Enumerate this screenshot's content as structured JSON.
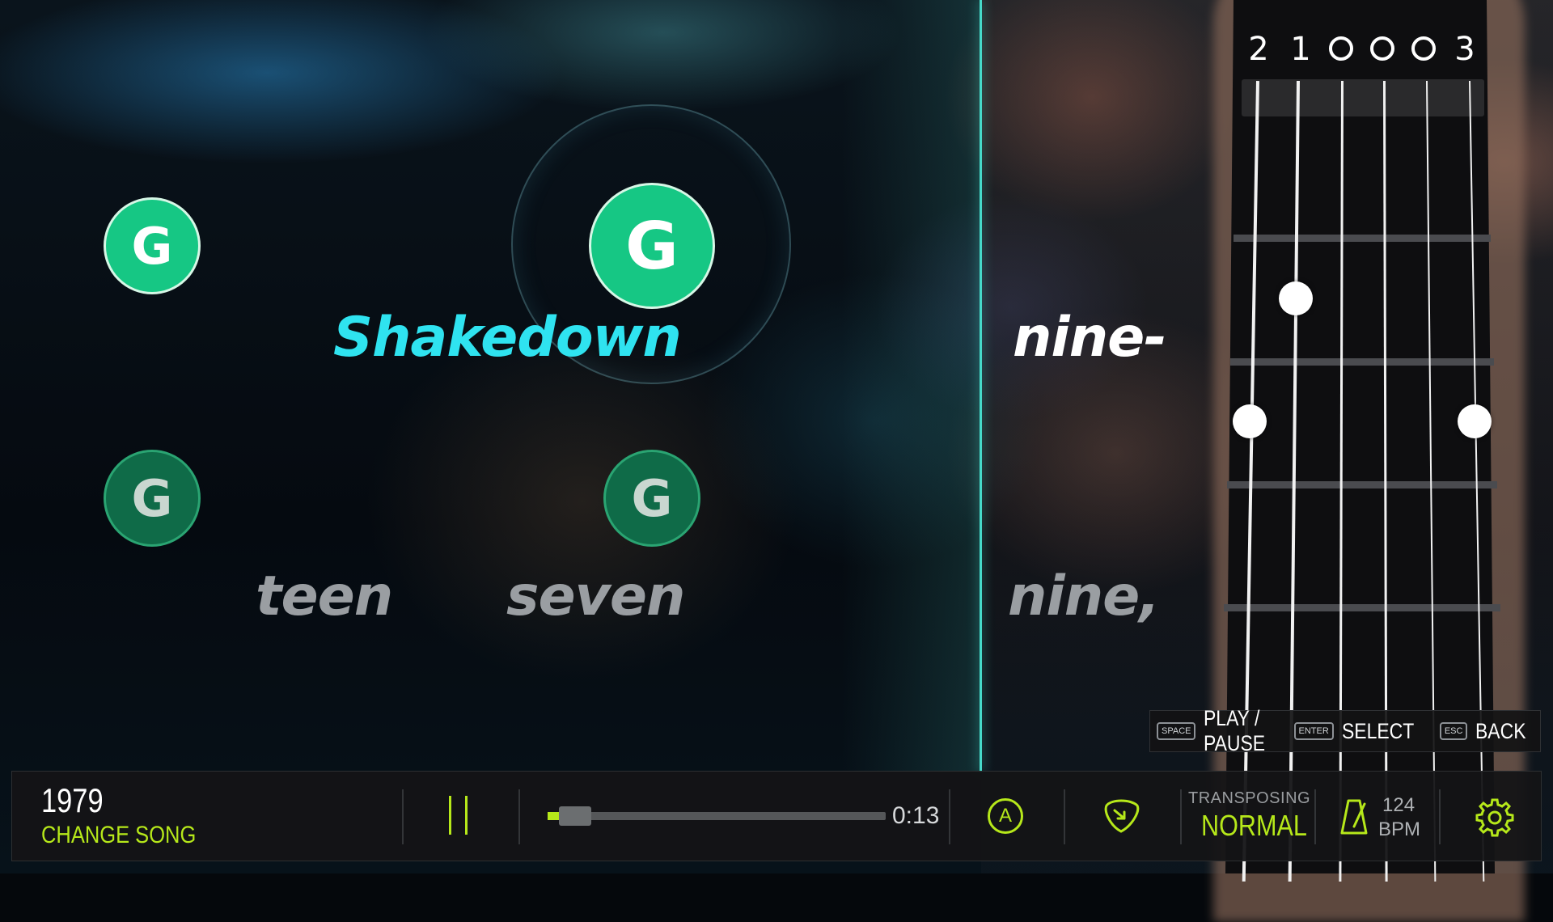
{
  "chords": {
    "top": [
      "G",
      "G"
    ],
    "bottom": [
      "G",
      "G"
    ]
  },
  "lyrics": {
    "line1": [
      "Shakedown",
      "nine-"
    ],
    "line2": [
      "teen",
      "seven",
      "nine,"
    ]
  },
  "fretboard": {
    "string_markers": [
      "2",
      "1",
      "o",
      "o",
      "o",
      "3"
    ]
  },
  "hints": {
    "play_key": "SPACE",
    "play_label": "PLAY / PAUSE",
    "select_key": "ENTER",
    "select_label": "SELECT",
    "back_key": "ESC",
    "back_label": "BACK"
  },
  "bottom_bar": {
    "song_title": "1979",
    "change_song": "CHANGE SONG",
    "progress_fraction": 0.015,
    "time": "0:13",
    "auto_label": "A",
    "transposing_label": "TRANSPOSING",
    "transposing_value": "NORMAL",
    "bpm_value": "124",
    "bpm_label": "BPM"
  },
  "colors": {
    "accent": "#b6e81a",
    "chord_green": "#16c784",
    "active_lyric": "#2fe3f0",
    "playline": "#46d9c9"
  },
  "icons": [
    "pause-icon",
    "auto-icon",
    "pick-icon",
    "metronome-icon",
    "gear-icon"
  ]
}
